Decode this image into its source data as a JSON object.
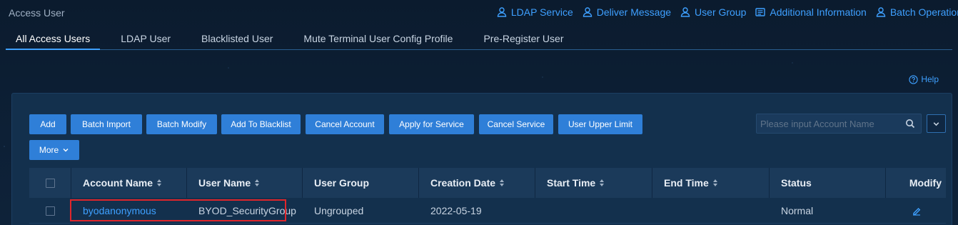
{
  "page": {
    "title": "Access User"
  },
  "top_actions": [
    {
      "label": "LDAP Service",
      "icon": "user-icon"
    },
    {
      "label": "Deliver Message",
      "icon": "user-icon"
    },
    {
      "label": "User Group",
      "icon": "user-icon"
    },
    {
      "label": "Additional Information",
      "icon": "list-icon"
    },
    {
      "label": "Batch Operation",
      "icon": "user-icon"
    }
  ],
  "tabs": [
    {
      "label": "All Access Users",
      "active": true
    },
    {
      "label": "LDAP User",
      "active": false
    },
    {
      "label": "Blacklisted User",
      "active": false
    },
    {
      "label": "Mute Terminal User Config Profile",
      "active": false
    },
    {
      "label": "Pre-Register User",
      "active": false
    }
  ],
  "help": {
    "label": "Help",
    "icon": "help-circle-icon"
  },
  "toolbar": {
    "buttons": [
      "Add",
      "Batch Import",
      "Batch Modify",
      "Add To Blacklist",
      "Cancel Account",
      "Apply for Service",
      "Cancel Service",
      "User Upper Limit"
    ],
    "more_label": "More"
  },
  "search": {
    "placeholder": "Please input Account Name",
    "value": ""
  },
  "table": {
    "columns": [
      {
        "label": "Account Name",
        "sortable": true
      },
      {
        "label": "User Name",
        "sortable": true
      },
      {
        "label": "User Group",
        "sortable": false
      },
      {
        "label": "Creation Date",
        "sortable": true
      },
      {
        "label": "Start Time",
        "sortable": true
      },
      {
        "label": "End Time",
        "sortable": true
      },
      {
        "label": "Status",
        "sortable": false
      },
      {
        "label": "Modify",
        "sortable": false
      }
    ],
    "rows": [
      {
        "account_name": "byodanonymous",
        "user_name": "BYOD_SecurityGroup",
        "user_group": "Ungrouped",
        "creation_date": "2022-05-19",
        "start_time": "",
        "end_time": "",
        "status": "Normal",
        "modify_icon": "edit-pencil-icon"
      }
    ]
  },
  "colors": {
    "accent": "#3ea0ff",
    "button": "#2f7fd8",
    "highlight": "#e0262b",
    "background": "#0a1a2c"
  }
}
